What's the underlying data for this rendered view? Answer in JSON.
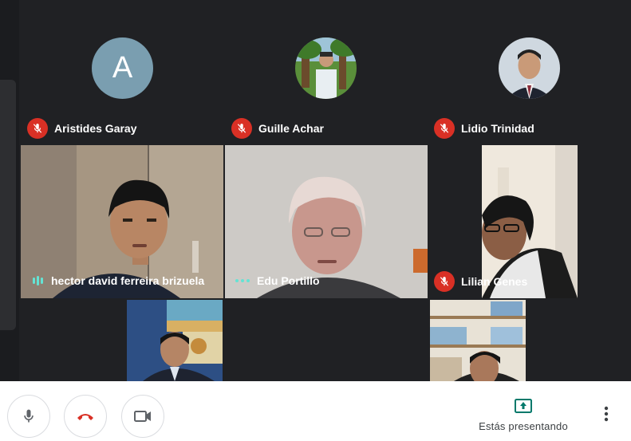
{
  "participants": {
    "aristides": {
      "name": "Aristides Garay",
      "initial": "A",
      "status": "muted"
    },
    "guille": {
      "name": "Guille Achar",
      "status": "muted"
    },
    "lidio": {
      "name": "Lidio Trinidad",
      "status": "muted"
    },
    "hector": {
      "name": "hector david ferreira brizuela",
      "status": "speaking"
    },
    "edu": {
      "name": "Edu Portillo",
      "status": "speaking"
    },
    "lilian": {
      "name": "Lilian Genes",
      "status": "muted"
    }
  },
  "controls": {
    "mic_icon": "microphone-icon",
    "hangup_icon": "phone-hangup-icon",
    "camera_icon": "videocam-icon",
    "present_icon": "present-to-all-icon",
    "present_label": "Estás presentando",
    "more_icon": "more-vert-icon"
  },
  "colors": {
    "background": "#202124",
    "mute_badge": "#d93025",
    "speaking_indicator": "#64e3d4",
    "hangup": "#d93025",
    "present_accent": "#00796b"
  }
}
